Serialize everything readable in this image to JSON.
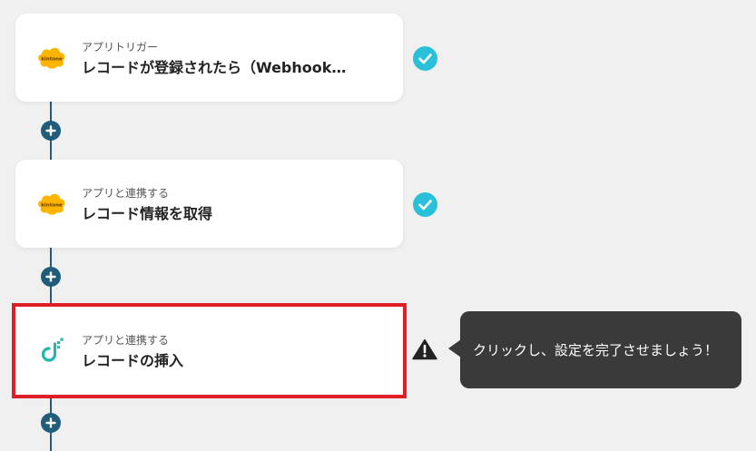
{
  "steps": [
    {
      "subtitle": "アプリトリガー",
      "title": "レコードが登録されたら（Webhook…",
      "icon": "kintone-icon",
      "status": "check-icon"
    },
    {
      "subtitle": "アプリと連携する",
      "title": "レコード情報を取得",
      "icon": "kintone-icon",
      "status": "check-icon"
    },
    {
      "subtitle": "アプリと連携する",
      "title": "レコードの挿入",
      "icon": "docutize-app-icon",
      "status": "warning-icon"
    }
  ],
  "tooltip": {
    "text": "クリックし、設定を完了させましょう！"
  },
  "colors": {
    "background": "#f0f0f0",
    "connector": "#1f5d7a",
    "check": "#2bc0d9",
    "highlight": "#e01e28",
    "kintone": "#ffb400",
    "tooltip": "#3a3a3a",
    "app_teal": "#25b6b0"
  }
}
